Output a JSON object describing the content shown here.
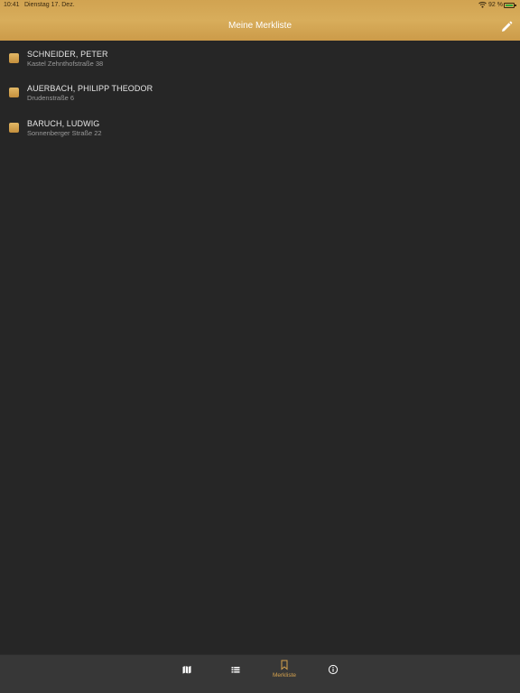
{
  "status_bar": {
    "time": "10:41",
    "date": "Dienstag 17. Dez.",
    "battery": "92 %"
  },
  "header": {
    "title": "Meine Merkliste",
    "edit_icon": "pencil-icon"
  },
  "list": {
    "items": [
      {
        "name": "SCHNEIDER, PETER",
        "address": "Kastel Zehnthofstraße 38"
      },
      {
        "name": "AUERBACH, PHILIPP THEODOR",
        "address": "Drudenstraße 6"
      },
      {
        "name": "BARUCH, LUDWIG",
        "address": "Sonnenberger Straße 22"
      }
    ]
  },
  "tabs": [
    {
      "icon": "map-icon",
      "label": ""
    },
    {
      "icon": "list-icon",
      "label": ""
    },
    {
      "icon": "bookmark-icon",
      "label": "Merkliste",
      "active": true
    },
    {
      "icon": "info-icon",
      "label": ""
    }
  ],
  "colors": {
    "accent": "#d4a24e",
    "background": "#262626",
    "tabbar": "#373737"
  }
}
